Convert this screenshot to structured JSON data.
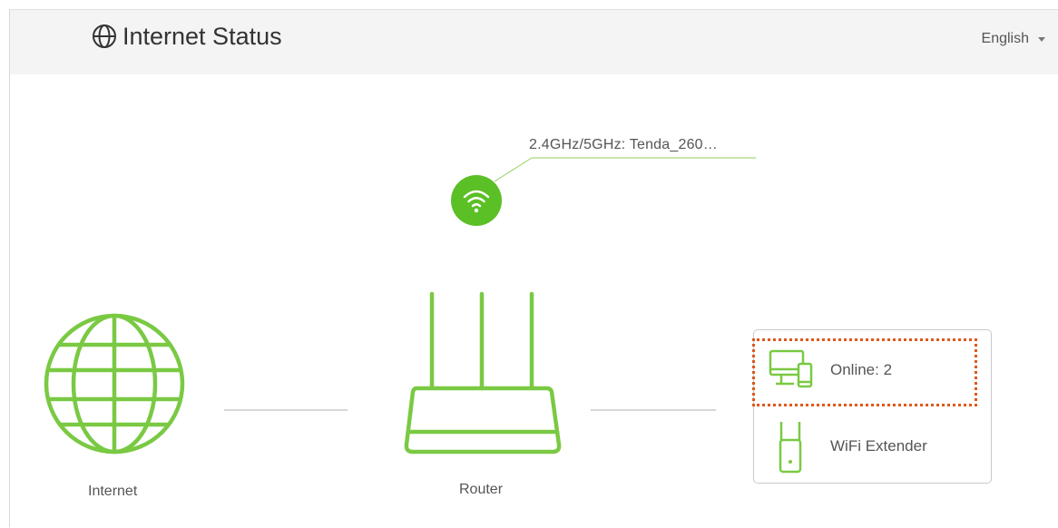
{
  "header": {
    "title": "Internet Status",
    "title_icon": "globe-icon",
    "language": "English"
  },
  "wifi": {
    "icon": "wifi-icon",
    "ssid_label": "2.4GHz/5GHz: Tenda_260…"
  },
  "topology": {
    "internet_label": "Internet",
    "router_label": "Router"
  },
  "devices": {
    "online_label": "Online:  2",
    "extender_label": "WiFi Extender"
  },
  "colors": {
    "accent_green": "#7ac943",
    "wifi_green": "#5bbf26",
    "highlight_orange": "#e0581b",
    "header_bg": "#f4f4f4"
  }
}
